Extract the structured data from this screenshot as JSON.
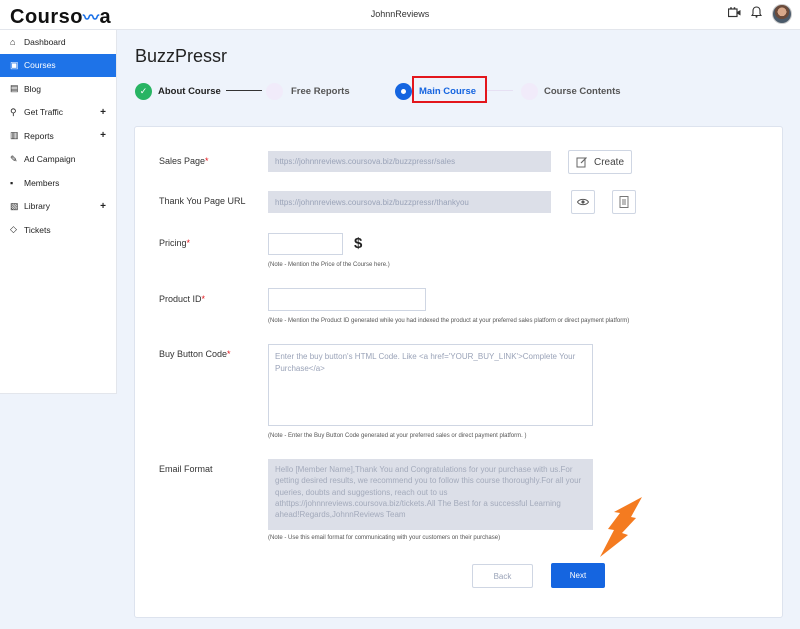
{
  "app": {
    "logo_text": "Courso",
    "logo_suffix": "a",
    "top_title": "JohnnReviews"
  },
  "sidebar": {
    "items": [
      {
        "label": "Dashboard",
        "icon": "home-icon",
        "active": false,
        "expandable": false
      },
      {
        "label": "Courses",
        "icon": "courses-icon",
        "active": true,
        "expandable": false
      },
      {
        "label": "Blog",
        "icon": "blog-icon",
        "active": false,
        "expandable": false
      },
      {
        "label": "Get Traffic",
        "icon": "traffic-icon",
        "active": false,
        "expandable": true
      },
      {
        "label": "Reports",
        "icon": "reports-icon",
        "active": false,
        "expandable": true
      },
      {
        "label": "Ad Campaign",
        "icon": "megaphone-icon",
        "active": false,
        "expandable": false
      },
      {
        "label": "Members",
        "icon": "members-icon",
        "active": false,
        "expandable": false
      },
      {
        "label": "Library",
        "icon": "library-icon",
        "active": false,
        "expandable": true
      },
      {
        "label": "Tickets",
        "icon": "ticket-icon",
        "active": false,
        "expandable": false
      }
    ],
    "plus": "+"
  },
  "page": {
    "title": "BuzzPressr"
  },
  "steps": [
    {
      "label": "About Course",
      "state": "done"
    },
    {
      "label": "Free Reports",
      "state": "pending"
    },
    {
      "label": "Main Course",
      "state": "current"
    },
    {
      "label": "Course Contents",
      "state": "pending"
    }
  ],
  "form": {
    "sales_page": {
      "label": "Sales Page",
      "value": "https://johnnreviews.coursova.biz/buzzpressr/sales",
      "create_label": "Create"
    },
    "thank_you": {
      "label": "Thank You Page URL",
      "value": "https://johnnreviews.coursova.biz/buzzpressr/thankyou"
    },
    "pricing": {
      "label": "Pricing",
      "value": "",
      "currency": "$",
      "note": "(Note - Mention the Price of the Course here.)"
    },
    "product_id": {
      "label": "Product ID",
      "value": "",
      "note": "(Note - Mention the Product ID generated while you had indexed the product at your preferred sales platform or direct payment platform)"
    },
    "buy_button": {
      "label": "Buy Button Code",
      "placeholder": "Enter the buy button's HTML Code. Like <a href='YOUR_BUY_LINK'>Complete Your Purchase</a>",
      "note": "(Note - Enter the Buy Button Code generated at your preferred sales or direct payment platform. )"
    },
    "email_format": {
      "label": "Email Format",
      "value": "Hello [Member Name],Thank You and Congratulations for your purchase with us.For getting desired results, we recommend you to follow this course thoroughly.For all your queries, doubts and suggestions, reach out to us athttps://johnnreviews.coursova.biz/tickets.All The Best for a successful Learning ahead!Regards,JohnnReviews Team",
      "note": "(Note - Use this email format for communicating with your customers on their purchase)"
    },
    "required_marker": "*",
    "back_label": "Back",
    "next_label": "Next"
  },
  "colors": {
    "accent": "#1e73e8",
    "highlight": "#e3161c",
    "arrow": "#f47b20",
    "step_done": "#28b463"
  }
}
